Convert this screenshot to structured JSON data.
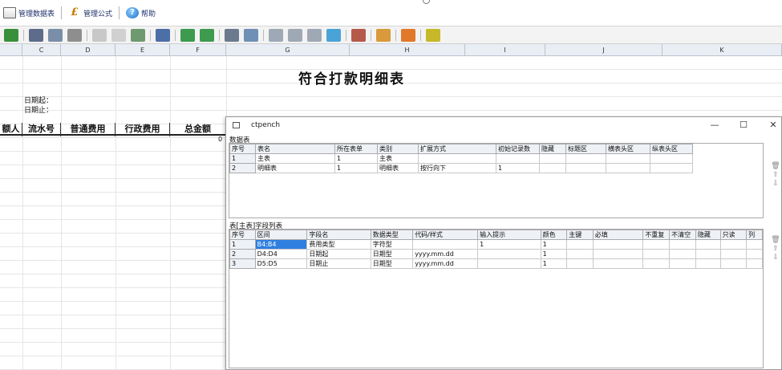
{
  "menu": {
    "items": [
      {
        "label": "管理数据表",
        "icon": "table-manage-icon"
      },
      {
        "label": "管理公式",
        "icon": "formula-icon"
      },
      {
        "label": "帮助",
        "icon": "help-icon"
      }
    ]
  },
  "columns": [
    "C",
    "D",
    "E",
    "F",
    "G",
    "H",
    "I",
    "J",
    "K"
  ],
  "sheet": {
    "title": "符合打款明细表",
    "date_start_label": "日期起：",
    "date_end_label": "日期止：",
    "headers": [
      "额人",
      "流水号",
      "普通费用",
      "行政费用",
      "总金额"
    ],
    "total_value": "0"
  },
  "dialog": {
    "title": "ctpench",
    "minimize": "—",
    "maximize": "☐",
    "close": "✕",
    "datatable": {
      "label": "数据表",
      "columns": [
        "序号",
        "表名",
        "所在表单",
        "类别",
        "扩展方式",
        "初始记录数",
        "隐藏",
        "标题区",
        "横表头区",
        "纵表头区"
      ],
      "rows": [
        [
          "1",
          "主表",
          "1",
          "主表",
          "",
          "",
          "",
          "",
          "",
          ""
        ],
        [
          "2",
          "明细表",
          "1",
          "明细表",
          "按行向下",
          "1",
          "",
          "",
          "",
          ""
        ]
      ]
    },
    "fieldlist": {
      "label": "表[主表]字段列表",
      "columns": [
        "序号",
        "区间",
        "字段名",
        "数据类型",
        "代码/样式",
        "输入提示",
        "颜色",
        "主键",
        "必填",
        "不重复",
        "不清空",
        "隐藏",
        "只读",
        "列"
      ],
      "rows": [
        [
          "1",
          "B4:B4",
          "费用类型",
          "字符型",
          "",
          "1",
          "1",
          "",
          "",
          "",
          "",
          "",
          "",
          ""
        ],
        [
          "2",
          "D4:D4",
          "日期起",
          "日期型",
          "yyyy.mm.dd",
          "",
          "1",
          "",
          "",
          "",
          "",
          "",
          "",
          ""
        ],
        [
          "3",
          "D5:D5",
          "日期止",
          "日期型",
          "yyyy.mm.dd",
          "",
          "1",
          "",
          "",
          "",
          "",
          "",
          "",
          ""
        ]
      ]
    }
  },
  "colors": {
    "selection": "#2f7fe0",
    "column_header_bg": "#e9eef5",
    "menu_text": "#1d2f6a"
  }
}
